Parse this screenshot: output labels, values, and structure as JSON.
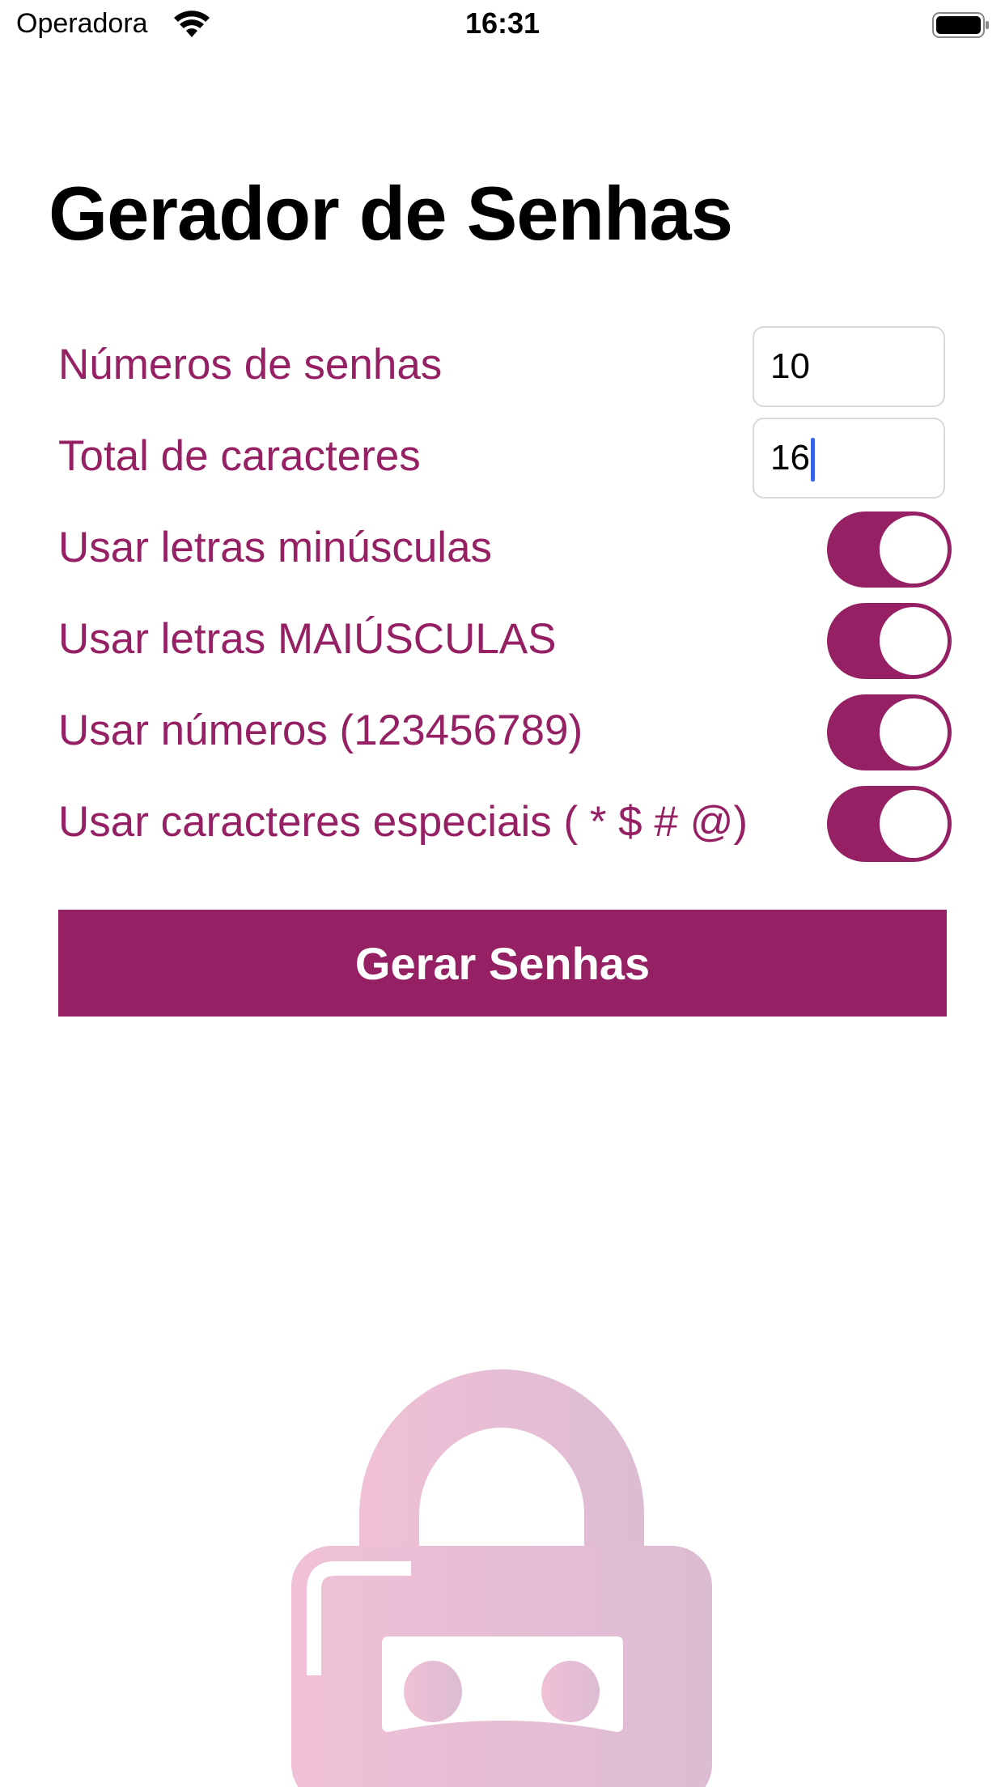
{
  "status_bar": {
    "carrier": "Operadora",
    "time": "16:31"
  },
  "page": {
    "title": "Gerador de Senhas"
  },
  "form": {
    "num_passwords": {
      "label": "Números de senhas",
      "value": "10"
    },
    "total_chars": {
      "label": "Total de caracteres",
      "value": "16"
    },
    "toggles": [
      {
        "label": "Usar letras minúsculas",
        "on": true
      },
      {
        "label": "Usar letras MAIÚSCULAS",
        "on": true
      },
      {
        "label": "Usar números (123456789)",
        "on": true
      },
      {
        "label": "Usar caracteres especiais ( * $ # @)",
        "on": true
      }
    ]
  },
  "actions": {
    "generate_label": "Gerar Senhas"
  },
  "colors": {
    "accent": "#962064",
    "lock_light": "#f0c0d6",
    "lock_dark": "#dcbcd2"
  },
  "icons": {
    "lock": "padlock-illustration"
  }
}
